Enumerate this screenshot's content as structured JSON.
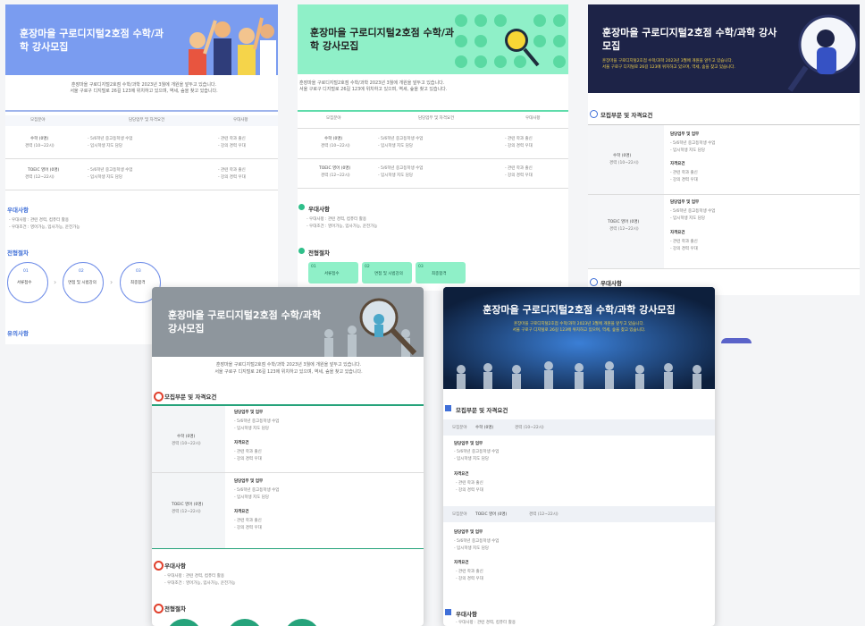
{
  "posting": {
    "title": "훈장마을 구로디지털2호점 수학/과학 강사모집",
    "intro_line1": "훈장마을 구로디지털2호점 수학/과학 2023년 3월에 개원을 앞두고 있습니다.",
    "intro_line2": "서울 구로구 디지털로 26길 123에 위치하고 있으며, 역세, 숲을 찾고 있습니다."
  },
  "table": {
    "headers": [
      "모집분야",
      "담당업무 및 자격요건",
      "우대사항"
    ],
    "rows": [
      {
        "field": "수학 (0명)",
        "sub": "경력 (10~22시)",
        "duty1": "- 5/6학년 중고등학생 수업",
        "duty2": "- 입시학생 지도 담당",
        "pref1": "- 관련 학과 출신",
        "pref2": "- 강의 경력 우대"
      },
      {
        "field": "TOEIC 영어 (0명)",
        "sub": "경력 (12~22시)",
        "duty1": "- 5/6학년 중고등학생 수업",
        "duty2": "- 입시학생 지도 담당",
        "pref1": "- 관련 학과 출신",
        "pref2": "- 강의 경력 우대"
      }
    ]
  },
  "sections": {
    "preference": "우대사항",
    "process": "전형절차",
    "notice": "유의사항",
    "recruit": "모집부문 및 자격요건"
  },
  "preference_items": [
    "- 우대사항 : 관련 경력, 컴퓨터 활용",
    "- 우대조건 : 영어가능, 입사가능, 운전가능"
  ],
  "steps": [
    {
      "num": "01",
      "label": "서류접수"
    },
    {
      "num": "02",
      "label": "면접 및 시범강의"
    },
    {
      "num": "03",
      "label": "최종합격"
    }
  ],
  "labels": {
    "duty": "담당업무 및 업무",
    "qual": "자격요건",
    "field_tag": "모집분야"
  },
  "colors": {
    "blue_banner": "#7a9cf0",
    "mint_banner": "#8ff0c8",
    "navy_banner": "#1d2347",
    "gray_banner": "#8e969d",
    "dark_banner": "#0d1f3c",
    "accent_blue": "#3f6fd8",
    "accent_green": "#2fbf8a",
    "accent_red": "#e0402c"
  }
}
